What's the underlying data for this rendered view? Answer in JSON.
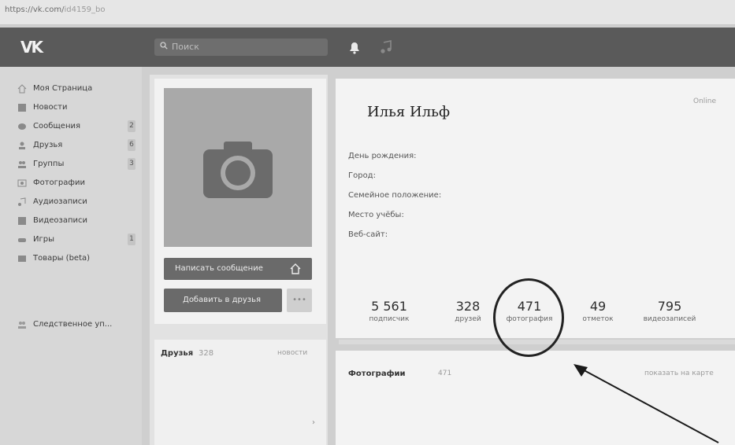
{
  "browser": {
    "url_main": "https://vk.com/",
    "url_rest": "id4159_bo"
  },
  "header": {
    "logo": "VK",
    "search_placeholder": "Поиск"
  },
  "sidebar": {
    "items": [
      {
        "label": "Моя Страница",
        "icon": "home-icon"
      },
      {
        "label": "Новости",
        "icon": "news-icon"
      },
      {
        "label": "Сообщения",
        "icon": "messages-icon",
        "count": "2"
      },
      {
        "label": "Друзья",
        "icon": "friends-icon",
        "count": "6"
      },
      {
        "label": "Группы",
        "icon": "groups-icon",
        "count": "3"
      },
      {
        "label": "Фотографии",
        "icon": "photos-icon"
      },
      {
        "label": "Аудиозаписи",
        "icon": "audio-icon"
      },
      {
        "label": "Видеозаписи",
        "icon": "video-icon"
      },
      {
        "label": "Игры",
        "icon": "games-icon",
        "count": "1"
      },
      {
        "label": "Товары (beta)",
        "icon": "goods-icon"
      }
    ],
    "extra": {
      "label": "Следственное уп..."
    }
  },
  "profile": {
    "name": "Илья Ильф",
    "online": "Online",
    "fields": [
      "День рождения:",
      "Город:",
      "Семейное положение:",
      "Место учёбы:",
      "Веб-сайт:"
    ],
    "stats": [
      {
        "value": "5 561",
        "label": "подписчик"
      },
      {
        "value": "328",
        "label": "друзей"
      },
      {
        "value": "471",
        "label": "фотография"
      },
      {
        "value": "49",
        "label": "отметок"
      },
      {
        "value": "795",
        "label": "видеозаписей"
      }
    ]
  },
  "actions": {
    "message": "Написать сообщение",
    "add_friend": "Добавить в друзья",
    "more": "•••"
  },
  "friends_block": {
    "title": "Друзья",
    "count": "328",
    "link": "новости"
  },
  "photos_block": {
    "title": "Фотографии",
    "count": "471",
    "link": "показать на карте"
  },
  "colors": {
    "header": "#5a5a5a",
    "button": "#6a6a6a",
    "page": "#d7d7d7"
  }
}
